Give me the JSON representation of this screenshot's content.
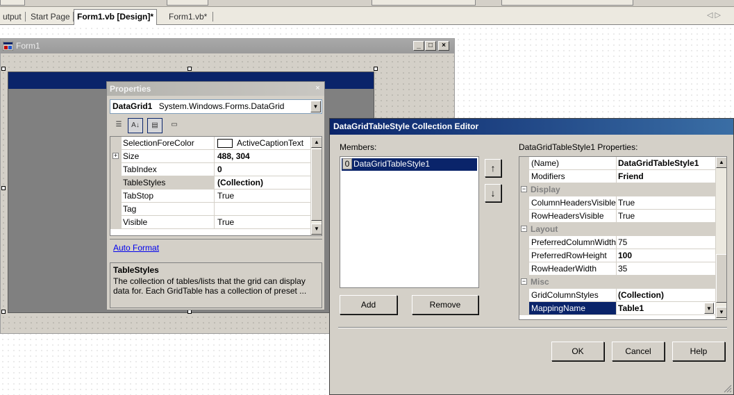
{
  "tabs": {
    "items": [
      {
        "label": "utput"
      },
      {
        "label": "Start Page"
      },
      {
        "label": "Form1.vb [Design]*"
      },
      {
        "label": "Form1.vb*"
      }
    ],
    "nav_arrows": "◁ ▷"
  },
  "form1": {
    "title": "Form1",
    "minimize": "_",
    "maximize": "□",
    "close": "×"
  },
  "properties_window": {
    "title": "Properties",
    "close": "×",
    "object_name": "DataGrid1",
    "object_type": "System.Windows.Forms.DataGrid",
    "toolbar": {
      "categorized_icon": "☰",
      "alphabetical_icon": "A↓",
      "properties_icon": "▤",
      "events_icon": "▭"
    },
    "rows": [
      {
        "name": "SelectionForeColor",
        "value": "ActiveCaptionText",
        "swatch": "#ffffff"
      },
      {
        "name": "Size",
        "value": "488, 304",
        "bold": true,
        "expander": "+"
      },
      {
        "name": "TabIndex",
        "value": "0",
        "bold": true
      },
      {
        "name": "TableStyles",
        "value": "(Collection)",
        "bold": true,
        "selected": true
      },
      {
        "name": "TabStop",
        "value": "True"
      },
      {
        "name": "Tag",
        "value": ""
      },
      {
        "name": "Visible",
        "value": "True"
      }
    ],
    "verb": "Auto Format",
    "description_title": "TableStyles",
    "description_text": "The collection of tables/lists that the grid can display data for.  Each GridTable has a collection of preset  ..."
  },
  "editor": {
    "title": "DataGridTableStyle Collection Editor",
    "members_label": "Members:",
    "members": [
      {
        "index": "0",
        "name": "DataGridTableStyle1"
      }
    ],
    "move_up": "↑",
    "move_down": "↓",
    "add_label": "Add",
    "remove_label": "Remove",
    "properties_label": "DataGridTableStyle1 Properties:",
    "rows": [
      {
        "type": "prop",
        "name": "(Name)",
        "value": "DataGridTableStyle1",
        "bold": true
      },
      {
        "type": "prop",
        "name": "Modifiers",
        "value": "Friend",
        "bold": true
      },
      {
        "type": "cat",
        "name": "Display",
        "expander": "−"
      },
      {
        "type": "prop",
        "name": "ColumnHeadersVisible",
        "value": "True"
      },
      {
        "type": "prop",
        "name": "RowHeadersVisible",
        "value": "True"
      },
      {
        "type": "cat",
        "name": "Layout",
        "expander": "−"
      },
      {
        "type": "prop",
        "name": "PreferredColumnWidth",
        "value": "75"
      },
      {
        "type": "prop",
        "name": "PreferredRowHeight",
        "value": "100",
        "bold": true
      },
      {
        "type": "prop",
        "name": "RowHeaderWidth",
        "value": "35"
      },
      {
        "type": "cat",
        "name": "Misc",
        "expander": "−"
      },
      {
        "type": "prop",
        "name": "GridColumnStyles",
        "value": "(Collection)",
        "bold": true
      },
      {
        "type": "prop",
        "name": "MappingName",
        "value": "Table1",
        "bold": true,
        "selected": true
      }
    ],
    "ok_label": "OK",
    "cancel_label": "Cancel",
    "help_label": "Help"
  },
  "colors": {
    "active_caption": "#0a246a",
    "control_face": "#d4d0c8",
    "datagrid_back": "#808080"
  }
}
